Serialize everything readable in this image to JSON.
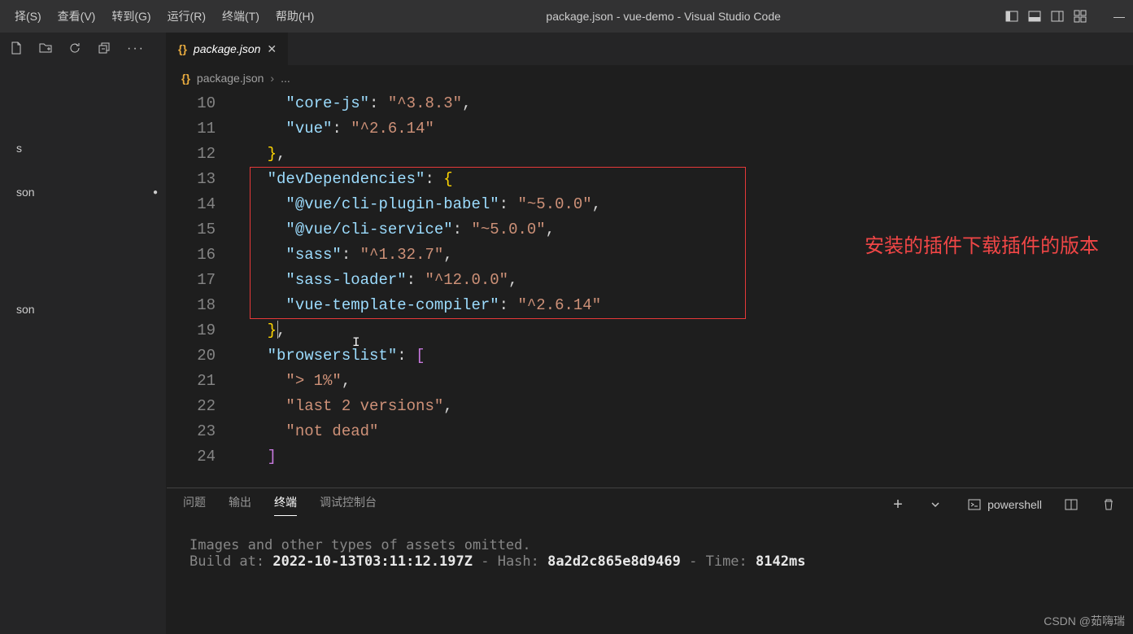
{
  "menu": [
    "择(S)",
    "查看(V)",
    "转到(G)",
    "运行(R)",
    "终端(T)",
    "帮助(H)"
  ],
  "window_title": "package.json - vue-demo - Visual Studio Code",
  "tab": {
    "filename": "package.json"
  },
  "breadcrumb": {
    "file": "package.json",
    "rest": "..."
  },
  "sidebar": {
    "item0": "s",
    "item1": "son"
  },
  "code": {
    "l10": {
      "indent": "      ",
      "k": "\"core-js\"",
      "c": ": ",
      "v": "\"^3.8.3\"",
      "t": ","
    },
    "l11": {
      "indent": "      ",
      "k": "\"vue\"",
      "c": ": ",
      "v": "\"^2.6.14\""
    },
    "l12": {
      "indent": "    ",
      "b": "}",
      "t": ","
    },
    "l13": {
      "indent": "    ",
      "k": "\"devDependencies\"",
      "c": ": ",
      "b": "{"
    },
    "l14": {
      "indent": "      ",
      "k": "\"@vue/cli-plugin-babel\"",
      "c": ": ",
      "v": "\"~5.0.0\"",
      "t": ","
    },
    "l15": {
      "indent": "      ",
      "k": "\"@vue/cli-service\"",
      "c": ": ",
      "v": "\"~5.0.0\"",
      "t": ","
    },
    "l16": {
      "indent": "      ",
      "k": "\"sass\"",
      "c": ": ",
      "v": "\"^1.32.7\"",
      "t": ","
    },
    "l17": {
      "indent": "      ",
      "k": "\"sass-loader\"",
      "c": ": ",
      "v": "\"^12.0.0\"",
      "t": ","
    },
    "l18": {
      "indent": "      ",
      "k": "\"vue-template-compiler\"",
      "c": ": ",
      "v": "\"^2.6.14\""
    },
    "l19": {
      "indent": "    ",
      "b": "}",
      "t": ","
    },
    "l20": {
      "indent": "    ",
      "k": "\"browserslist\"",
      "c": ": ",
      "b": "["
    },
    "l21": {
      "indent": "      ",
      "v": "\"> 1%\"",
      "t": ","
    },
    "l22": {
      "indent": "      ",
      "v": "\"last 2 versions\"",
      "t": ","
    },
    "l23": {
      "indent": "      ",
      "v": "\"not dead\""
    },
    "l24": {
      "indent": "    ",
      "b": "]"
    }
  },
  "line_numbers": [
    "10",
    "11",
    "12",
    "13",
    "14",
    "15",
    "16",
    "17",
    "18",
    "19",
    "20",
    "21",
    "22",
    "23",
    "24"
  ],
  "annotation": "安装的插件下载插件的版本",
  "panel": {
    "tabs": [
      "问题",
      "输出",
      "终端",
      "调试控制台"
    ],
    "powershell": "powershell",
    "out1": "Images and other types of assets omitted.",
    "out2_a": "Build at: ",
    "out2_b": "2022-10-13T03:11:12.197Z",
    "out2_c": " - Hash: ",
    "out2_d": "8a2d2c865e8d9469",
    "out2_e": " - Time: ",
    "out2_f": "8142ms"
  },
  "watermark": "CSDN @茹嗨瑞"
}
